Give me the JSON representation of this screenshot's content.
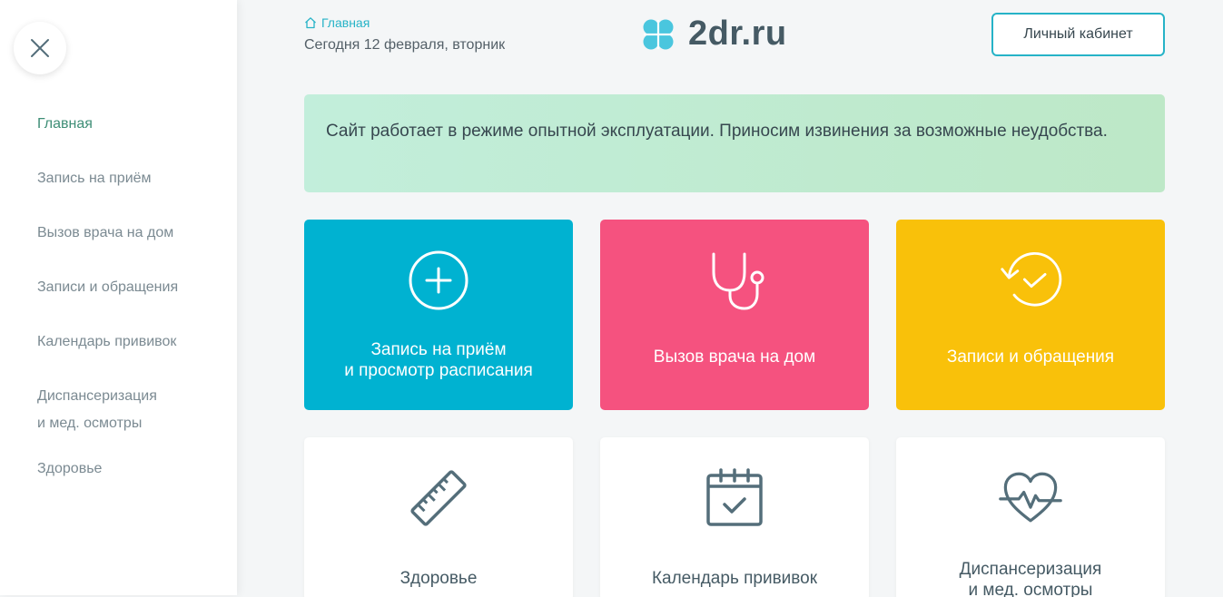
{
  "sidebar": {
    "items": [
      {
        "label": "Главная",
        "active": true
      },
      {
        "label": "Запись на приём"
      },
      {
        "label": "Вызов врача на дом"
      },
      {
        "label": "Записи и обращения"
      },
      {
        "label": "Календарь прививок"
      },
      {
        "label": "Диспансеризация"
      },
      {
        "label": "и мед. осмотры"
      },
      {
        "label": "Здоровье"
      }
    ]
  },
  "header": {
    "breadcrumb": "Главная",
    "today": "Сегодня 12 февраля, вторник",
    "logo_text": "2dr.ru",
    "cabinet_button": "Личный кабинет"
  },
  "notice": {
    "text": "Сайт работает в режиме опытной эксплуатации. Приносим извинения за возможные неудобства."
  },
  "tiles": [
    {
      "label": "Запись на приём\nи просмотр расписания",
      "color": "#00b2d1",
      "icon": "plus-circle-icon"
    },
    {
      "label": "Вызов врача на дом",
      "color": "#f5527f",
      "icon": "stethoscope-icon"
    },
    {
      "label": "Записи и обращения",
      "color": "#f9c10a",
      "icon": "history-clock-icon"
    },
    {
      "label": "Здоровье",
      "icon": "ruler-icon"
    },
    {
      "label": "Календарь прививок",
      "icon": "calendar-check-icon"
    },
    {
      "label": "Диспансеризация\nи мед. осмотры",
      "icon": "heart-pulse-icon"
    }
  ],
  "colors": {
    "accent": "#26b3c7",
    "active_nav": "#3e8e76",
    "icon_gray": "#546e7a"
  }
}
